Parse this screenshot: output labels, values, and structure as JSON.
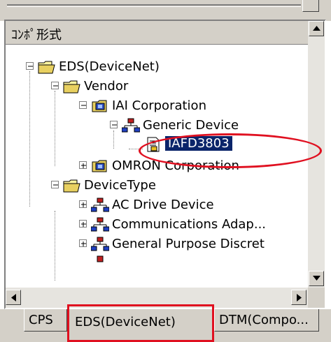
{
  "header": {
    "title": "ｺﾝﾎﾟ形式"
  },
  "tree": {
    "items": [
      {
        "label": "EDS(DeviceNet)",
        "icon": "folder-icon"
      },
      {
        "label": "Vendor",
        "icon": "folder-icon"
      },
      {
        "label": "IAI Corporation",
        "icon": "vendor-device-icon"
      },
      {
        "label": "Generic Device",
        "icon": "network-icon"
      },
      {
        "label": "IAFD3803",
        "icon": "eds-file-icon",
        "selected": true
      },
      {
        "label": "OMRON Corporation",
        "icon": "vendor-device-icon"
      },
      {
        "label": "DeviceType",
        "icon": "folder-icon"
      },
      {
        "label": "AC Drive Device",
        "icon": "network-icon"
      },
      {
        "label": "Communications Adap...",
        "icon": "network-icon"
      },
      {
        "label": "General Purpose Discret",
        "icon": "network-icon"
      }
    ]
  },
  "tabs": [
    {
      "label": "CPS"
    },
    {
      "label": "EDS(DeviceNet)",
      "active": true
    },
    {
      "label": "DTM(Compo..."
    }
  ],
  "colors": {
    "highlight": "#0a246a",
    "annotation": "#e01020",
    "chrome": "#d4d0c8"
  }
}
